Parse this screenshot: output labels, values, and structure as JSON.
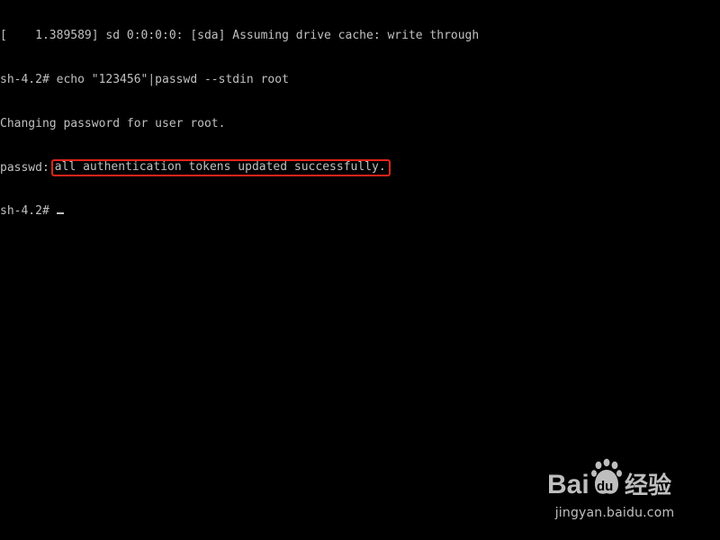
{
  "terminal": {
    "lines": {
      "kernel_msg": "[    1.389589] sd 0:0:0:0: [sda] Assuming drive cache: write through",
      "command": "sh-4.2# echo \"123456\"|passwd --stdin root",
      "changing": "Changing password for user root.",
      "passwd_prefix": "passwd:",
      "passwd_result": "all authentication tokens updated successfully.",
      "prompt": "sh-4.2#"
    }
  },
  "watermark": {
    "brand_latin": "Bai",
    "brand_latin2": "du",
    "brand_cn": "经验",
    "url": "jingyan.baidu.com"
  },
  "colors": {
    "background": "#000000",
    "terminal_text": "#c0c0c0",
    "highlight_border": "#e0241b"
  }
}
